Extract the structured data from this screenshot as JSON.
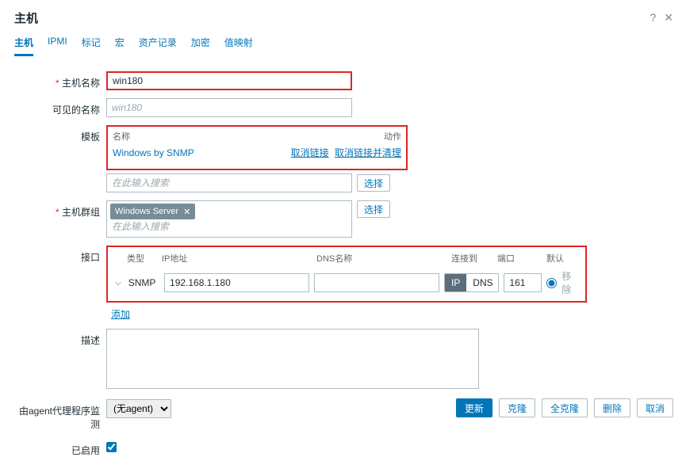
{
  "header": {
    "title": "主机"
  },
  "tabs": [
    "主机",
    "IPMI",
    "标记",
    "宏",
    "资产记录",
    "加密",
    "值映射"
  ],
  "activeTab": 0,
  "labels": {
    "hostname": "主机名称",
    "visibleName": "可见的名称",
    "templates": "模板",
    "hostGroups": "主机群组",
    "interfaces": "接口",
    "description": "描述",
    "proxy": "由agent代理程序监测",
    "enabled": "已启用"
  },
  "hostname": "win180",
  "visibleNamePlaceholder": "win180",
  "templates": {
    "columns": {
      "name": "名称",
      "action": "动作"
    },
    "items": [
      {
        "name": "Windows by SNMP",
        "actions": [
          "取消链接",
          "取消链接并清理"
        ]
      }
    ],
    "searchPlaceholder": "在此输入搜索",
    "selectBtn": "选择"
  },
  "hostGroups": {
    "chips": [
      "Windows Server"
    ],
    "searchPlaceholder": "在此输入搜索",
    "selectBtn": "选择"
  },
  "interfaces": {
    "columns": {
      "type": "类型",
      "ip": "IP地址",
      "dns": "DNS名称",
      "connectTo": "连接到",
      "port": "端口",
      "default": "默认"
    },
    "rows": [
      {
        "type": "SNMP",
        "ip": "192.168.1.180",
        "dns": "",
        "connectTo": "IP",
        "connectOptions": [
          "IP",
          "DNS"
        ],
        "port": "161",
        "isDefault": true
      }
    ],
    "addLabel": "添加",
    "removeLabel": "移除"
  },
  "description": "",
  "proxy": {
    "options": [
      "(无agent)"
    ],
    "selected": "(无agent)"
  },
  "enabled": true,
  "footerButtons": {
    "update": "更新",
    "clone": "克隆",
    "fullClone": "全克隆",
    "delete": "删除",
    "cancel": "取消"
  }
}
